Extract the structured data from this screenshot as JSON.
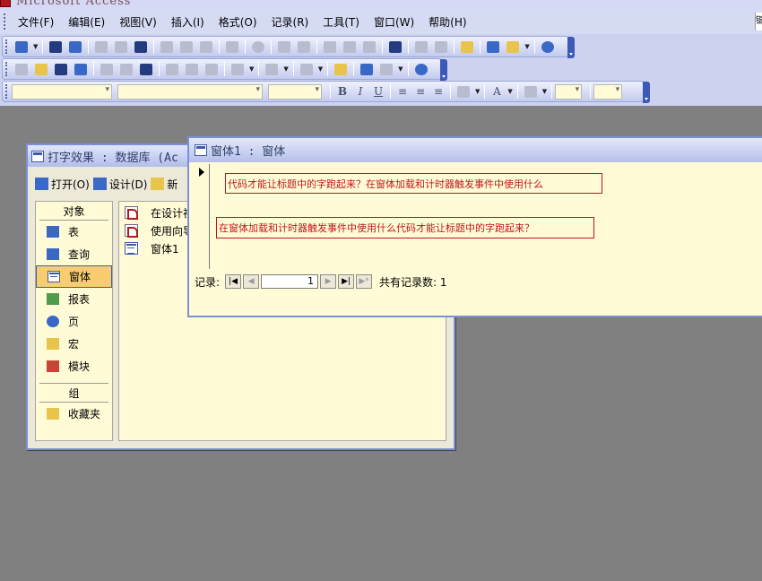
{
  "app": {
    "title": "Microsoft Access"
  },
  "menu": [
    "文件(F)",
    "编辑(E)",
    "视图(V)",
    "插入(I)",
    "格式(O)",
    "记录(R)",
    "工具(T)",
    "窗口(W)",
    "帮助(H)"
  ],
  "menu_right_fragment": "键",
  "database_window": {
    "title": "打字效果 : 数据库 (Ac",
    "toolbar": {
      "open_label": "打开(O)",
      "design_label": "设计(D)",
      "new_label": "新"
    },
    "objects_header": "对象",
    "objects": [
      {
        "label": "表",
        "icon": "table-icon"
      },
      {
        "label": "查询",
        "icon": "query-icon"
      },
      {
        "label": "窗体",
        "icon": "form-icon",
        "selected": true
      },
      {
        "label": "报表",
        "icon": "report-icon"
      },
      {
        "label": "页",
        "icon": "page-icon"
      },
      {
        "label": "宏",
        "icon": "macro-icon"
      },
      {
        "label": "模块",
        "icon": "module-icon"
      }
    ],
    "groups_header": "组",
    "groups": [
      {
        "label": "收藏夹",
        "icon": "favorites-icon"
      }
    ],
    "list_items": [
      {
        "label": "在设计视",
        "icon": "design-view-icon"
      },
      {
        "label": "使用向导",
        "icon": "wizard-icon"
      },
      {
        "label": "窗体1",
        "icon": "form-icon"
      }
    ]
  },
  "form_window": {
    "title": "窗体1 : 窗体",
    "label1": "代码才能让标题中的字跑起来？在窗体加载和计时器触发事件中使用什么",
    "label2": "在窗体加载和计时器触发事件中使用什么代码才能让标题中的字跑起来？",
    "nav": {
      "record_label": "记录:",
      "current_record": "1",
      "total_label": "共有记录数: 1"
    }
  },
  "colors": {
    "desktop": "#808080",
    "form_background": "#fffbd6",
    "label_text": "#c0161c",
    "selected_object": "#f7cd6d"
  }
}
